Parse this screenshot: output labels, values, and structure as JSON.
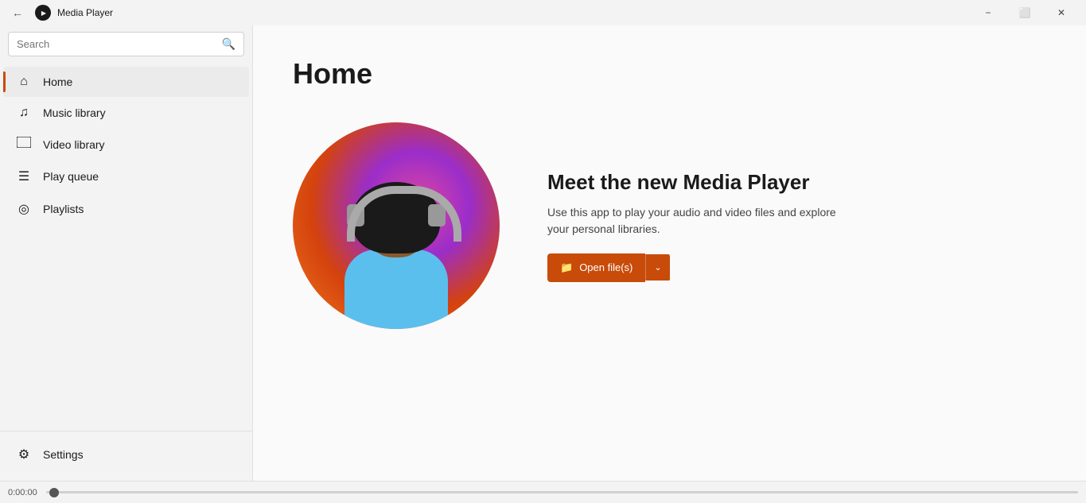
{
  "titlebar": {
    "title": "Media Player",
    "minimize_label": "−",
    "maximize_label": "⬜",
    "close_label": "✕"
  },
  "sidebar": {
    "search_placeholder": "Search",
    "nav_items": [
      {
        "id": "home",
        "label": "Home",
        "icon": "⌂",
        "active": true
      },
      {
        "id": "music-library",
        "label": "Music library",
        "icon": "♪"
      },
      {
        "id": "video-library",
        "label": "Video library",
        "icon": "▭"
      },
      {
        "id": "play-queue",
        "label": "Play queue",
        "icon": "≡"
      },
      {
        "id": "playlists",
        "label": "Playlists",
        "icon": "◎"
      }
    ],
    "settings_label": "Settings",
    "settings_icon": "⚙"
  },
  "progress": {
    "time": "0:00:00"
  },
  "main": {
    "page_title": "Home",
    "card_headline": "Meet the new Media Player",
    "card_subtext": "Use this app to play your audio and video files and explore your personal libraries.",
    "open_files_label": "Open file(s)"
  }
}
